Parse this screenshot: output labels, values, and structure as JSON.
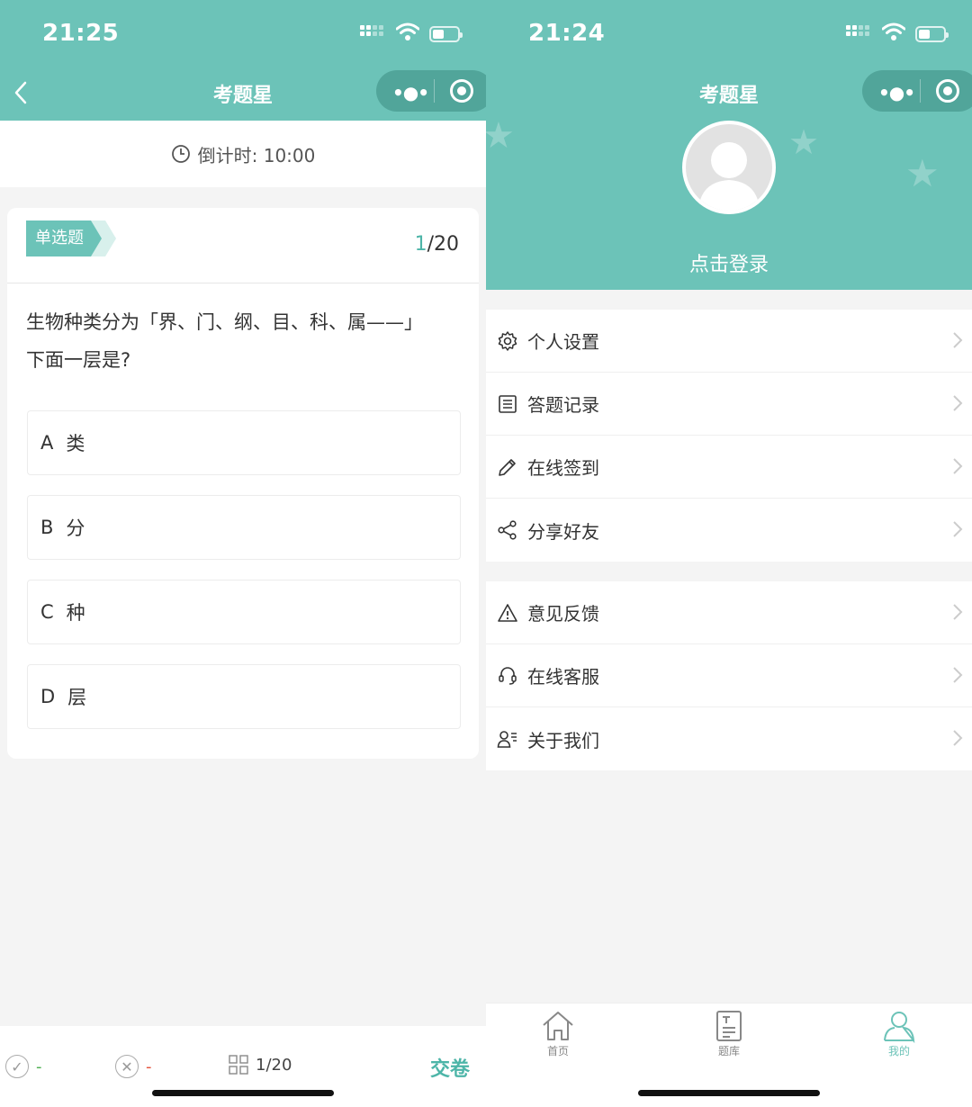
{
  "left": {
    "status_time": "21:25",
    "nav_title": "考题星",
    "countdown_label": "倒计时: 10:00",
    "question_type": "单选题",
    "question_index": "1",
    "question_total": "/20",
    "question_text": "生物种类分为「界、门、纲、目、科、属——」下面一层是?",
    "options": [
      {
        "letter": "A",
        "text": "类"
      },
      {
        "letter": "B",
        "text": "分"
      },
      {
        "letter": "C",
        "text": "种"
      },
      {
        "letter": "D",
        "text": "层"
      }
    ],
    "bottom": {
      "correct_count": "-",
      "wrong_count": "-",
      "progress": "1/20",
      "submit_label": "交卷"
    }
  },
  "right": {
    "status_time": "21:24",
    "nav_title": "考题星",
    "login_label": "点击登录",
    "menu_group1": [
      {
        "label": "个人设置",
        "icon": "gear-icon"
      },
      {
        "label": "答题记录",
        "icon": "list-icon"
      },
      {
        "label": "在线签到",
        "icon": "pencil-icon"
      },
      {
        "label": "分享好友",
        "icon": "share-icon"
      }
    ],
    "menu_group2": [
      {
        "label": "意见反馈",
        "icon": "warning-icon"
      },
      {
        "label": "在线客服",
        "icon": "headset-icon"
      },
      {
        "label": "关于我们",
        "icon": "user-info-icon"
      }
    ],
    "tabs": [
      {
        "label": "首页",
        "icon": "home-icon"
      },
      {
        "label": "题库",
        "icon": "document-icon"
      },
      {
        "label": "我的",
        "icon": "user-icon"
      }
    ]
  },
  "colors": {
    "accent": "#6cc3b8",
    "accent_text": "#4db5a8",
    "correct": "#4caf50",
    "wrong": "#e5533d"
  }
}
